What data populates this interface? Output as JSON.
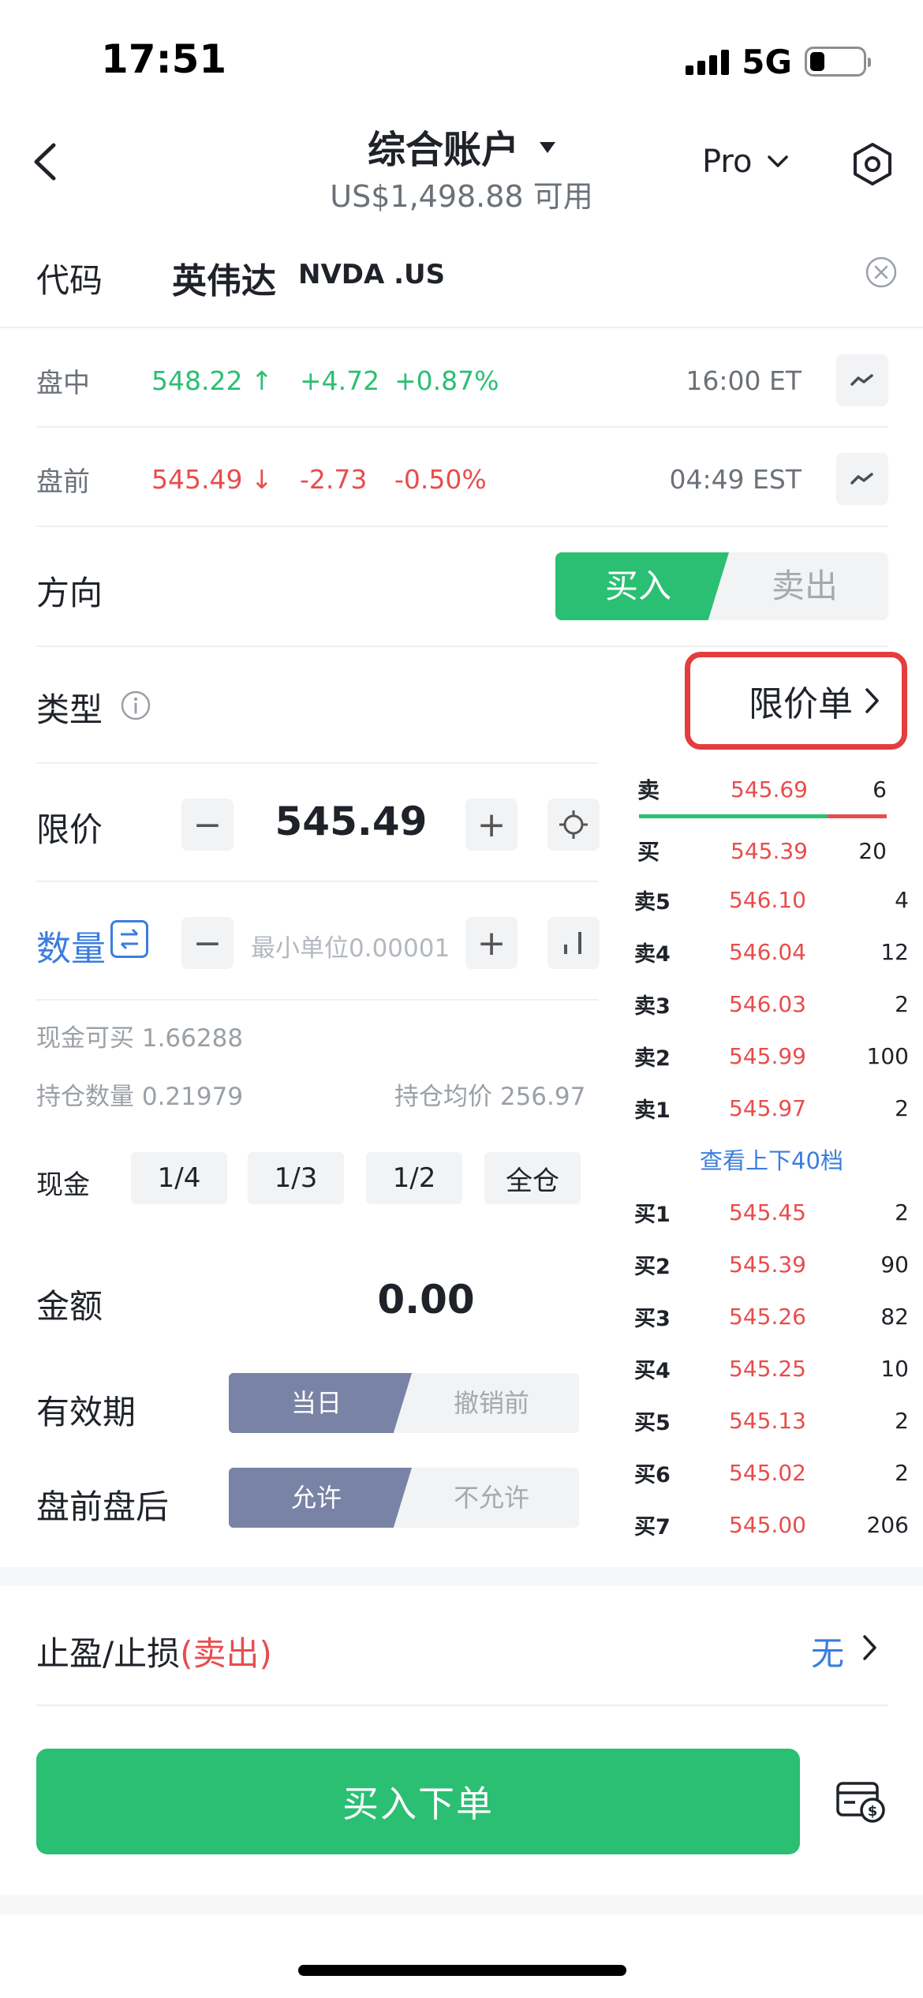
{
  "status_bar": {
    "time": "17:51",
    "network": "5G"
  },
  "nav": {
    "title": "综合账户",
    "subtitle": "US$1,498.88 可用",
    "pro_label": "Pro"
  },
  "code": {
    "label": "代码",
    "name": "英伟达",
    "ticker": "NVDA .US"
  },
  "quotes": [
    {
      "label": "盘中",
      "price": "548.22",
      "arrow": "↑",
      "change": "+4.72",
      "percent": "+0.87%",
      "time": "16:00 ET",
      "color": "#2bbf73"
    },
    {
      "label": "盘前",
      "price": "545.49",
      "arrow": "↓",
      "change": "-2.73",
      "percent": "-0.50%",
      "time": "04:49 EST",
      "color": "#e84d4d"
    }
  ],
  "direction": {
    "label": "方向",
    "buy": "买入",
    "sell": "卖出",
    "selected": "buy"
  },
  "order_type": {
    "label": "类型",
    "value": "限价单"
  },
  "limit": {
    "label": "限价",
    "value": "545.49"
  },
  "quantity": {
    "label": "数量",
    "placeholder": "最小单位0.00001"
  },
  "account_info": {
    "cash_buyable": "现金可买 1.66288",
    "position_qty": "持仓数量 0.21979",
    "avg_cost": "持仓均价 256.97"
  },
  "cash": {
    "label": "现金",
    "options": [
      "1/4",
      "1/3",
      "1/2",
      "全仓"
    ]
  },
  "amount": {
    "label": "金额",
    "value": "0.00"
  },
  "validity": {
    "label": "有效期",
    "on": "当日",
    "off": "撤销前"
  },
  "extended_hours": {
    "label": "盘前盘后",
    "on": "允许",
    "off": "不允许"
  },
  "order_book": {
    "best_ask": {
      "label": "卖",
      "price": "545.69",
      "volume": "6"
    },
    "best_bid": {
      "label": "买",
      "price": "545.39",
      "volume": "20"
    },
    "bid_ratio": 0.76,
    "asks": [
      {
        "level": "卖5",
        "price": "546.10",
        "volume": "4"
      },
      {
        "level": "卖4",
        "price": "546.04",
        "volume": "12"
      },
      {
        "level": "卖3",
        "price": "546.03",
        "volume": "2"
      },
      {
        "level": "卖2",
        "price": "545.99",
        "volume": "100"
      },
      {
        "level": "卖1",
        "price": "545.97",
        "volume": "2"
      }
    ],
    "more_label": "查看上下40档",
    "bids": [
      {
        "level": "买1",
        "price": "545.45",
        "volume": "2"
      },
      {
        "level": "买2",
        "price": "545.39",
        "volume": "90"
      },
      {
        "level": "买3",
        "price": "545.26",
        "volume": "82"
      },
      {
        "level": "买4",
        "price": "545.25",
        "volume": "10"
      },
      {
        "level": "买5",
        "price": "545.13",
        "volume": "2"
      },
      {
        "level": "买6",
        "price": "545.02",
        "volume": "2"
      },
      {
        "level": "买7",
        "price": "545.00",
        "volume": "206"
      }
    ]
  },
  "take_profit": {
    "label": "止盈/止损",
    "label_suffix": "(卖出)",
    "value": "无"
  },
  "submit": {
    "label": "买入下单"
  },
  "colors": {
    "green": "#2bbf73",
    "red": "#e84d4d",
    "blue": "#3b7ddd",
    "highlight": "#e43d3d"
  }
}
